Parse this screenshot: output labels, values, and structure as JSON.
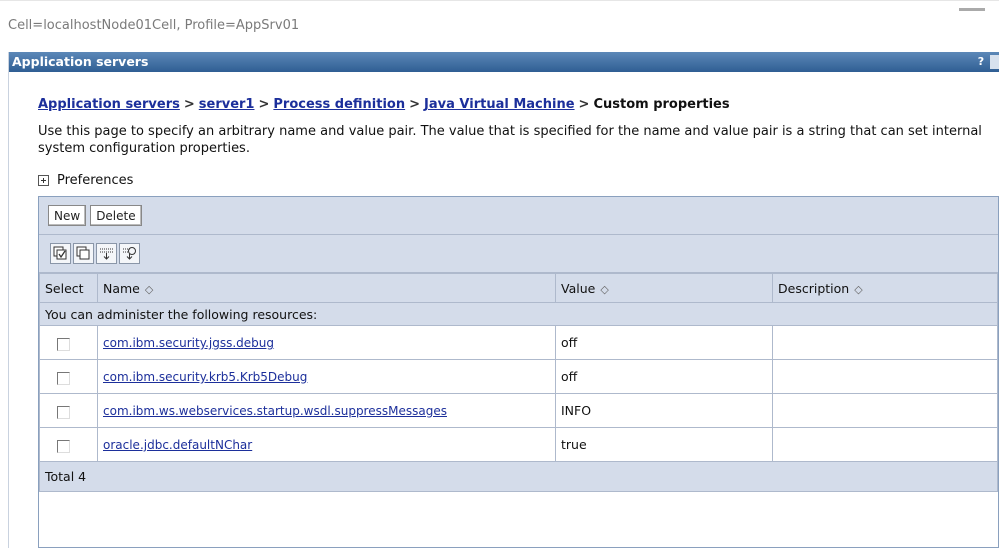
{
  "scope": "Cell=localhostNode01Cell, Profile=AppSrv01",
  "panel_title": "Application servers",
  "help_glyph": "?",
  "breadcrumb": {
    "items": [
      "Application servers",
      "server1",
      "Process definition",
      "Java Virtual Machine"
    ],
    "separator": ">",
    "current": "Custom properties"
  },
  "description": "Use this page to specify an arbitrary name and value pair. The value that is specified for the name and value pair is a string that can set internal system configuration properties.",
  "preferences_label": "Preferences",
  "buttons": {
    "new": "New",
    "delete": "Delete"
  },
  "toolbar_icons": [
    "select-all-icon",
    "deselect-all-icon",
    "show-filter-icon",
    "clear-filter-icon"
  ],
  "table": {
    "headers": {
      "select": "Select",
      "name": "Name",
      "value": "Value",
      "description": "Description"
    },
    "sort_glyph": "◇",
    "note": "You can administer the following resources:",
    "rows": [
      {
        "name": "com.ibm.security.jgss.debug",
        "value": "off",
        "description": ""
      },
      {
        "name": "com.ibm.security.krb5.Krb5Debug",
        "value": "off",
        "description": ""
      },
      {
        "name": "com.ibm.ws.webservices.startup.wsdl.suppressMessages",
        "value": "INFO",
        "description": ""
      },
      {
        "name": "oracle.jdbc.defaultNChar",
        "value": "true",
        "description": ""
      }
    ],
    "total": "Total 4"
  },
  "colors": {
    "titlebar": "#2f5e93",
    "link": "#1c2f9b",
    "tableband": "#d4dcea"
  }
}
